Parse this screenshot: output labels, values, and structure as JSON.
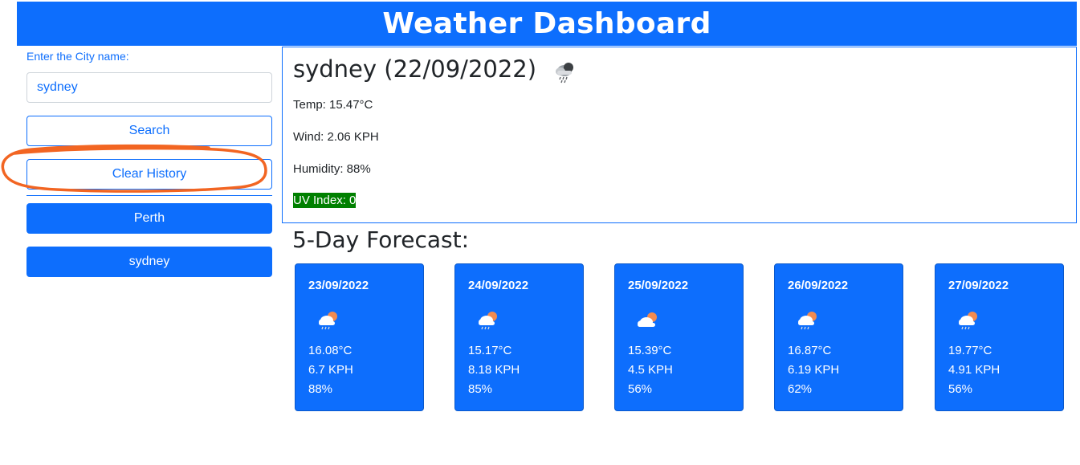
{
  "header": {
    "title": "Weather Dashboard"
  },
  "sidebar": {
    "city_label": "Enter the City name:",
    "city_value": "sydney",
    "search_label": "Search",
    "clear_label": "Clear History",
    "history": [
      "Perth",
      "sydney"
    ]
  },
  "current": {
    "title": "sydney (22/09/2022)",
    "icon": "rain-cloud-icon",
    "temp": "Temp: 15.47°C",
    "wind": "Wind: 2.06 KPH",
    "humidity": "Humidity: 88%",
    "uv": "UV Index: 0",
    "uv_color": "#008000"
  },
  "forecast": {
    "title": "5-Day Forecast:",
    "days": [
      {
        "date": "23/09/2022",
        "icon": "sun-rain-cloud-icon",
        "temp": "16.08°C",
        "wind": "6.7 KPH",
        "humidity": "88%"
      },
      {
        "date": "24/09/2022",
        "icon": "sun-rain-cloud-icon",
        "temp": "15.17°C",
        "wind": "8.18 KPH",
        "humidity": "85%"
      },
      {
        "date": "25/09/2022",
        "icon": "sun-cloud-icon",
        "temp": "15.39°C",
        "wind": "4.5 KPH",
        "humidity": "56%"
      },
      {
        "date": "26/09/2022",
        "icon": "sun-rain-cloud-icon",
        "temp": "16.87°C",
        "wind": "6.19 KPH",
        "humidity": "62%"
      },
      {
        "date": "27/09/2022",
        "icon": "sun-rain-cloud-icon",
        "temp": "19.77°C",
        "wind": "4.91 KPH",
        "humidity": "56%"
      }
    ]
  },
  "colors": {
    "primary": "#0d6efd",
    "annotation": "#f26522"
  }
}
